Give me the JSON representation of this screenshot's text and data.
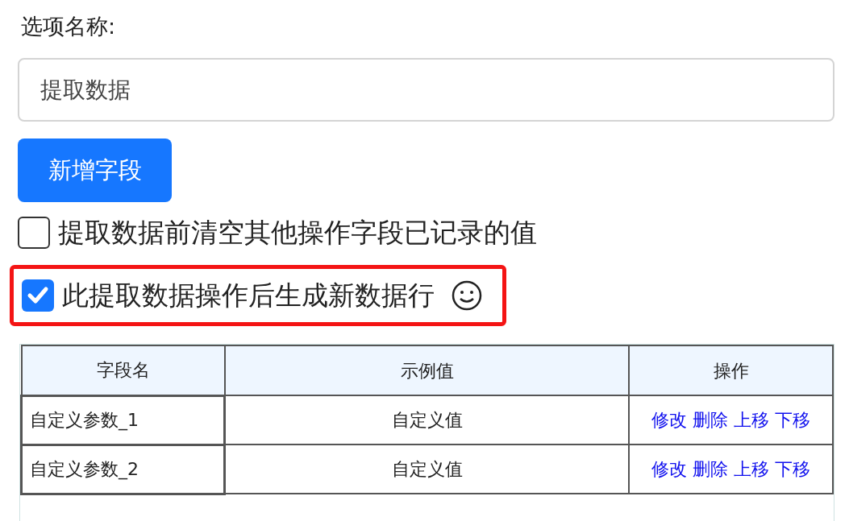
{
  "option_name": {
    "label": "选项名称:",
    "value": "提取数据"
  },
  "add_field_button": "新增字段",
  "options": [
    {
      "label": "提取数据前清空其他操作字段已记录的值",
      "checked": false,
      "highlighted": false
    },
    {
      "label": "此提取数据操作后生成新数据行",
      "checked": true,
      "highlighted": true
    }
  ],
  "table": {
    "columns": [
      "字段名",
      "示例值",
      "操作"
    ],
    "rows": [
      {
        "name": "自定义参数_1",
        "value": "自定义值",
        "actions": [
          "修改",
          "删除",
          "上移",
          "下移"
        ]
      },
      {
        "name": "自定义参数_2",
        "value": "自定义值",
        "actions": [
          "修改",
          "删除",
          "上移",
          "下移"
        ]
      }
    ]
  }
}
